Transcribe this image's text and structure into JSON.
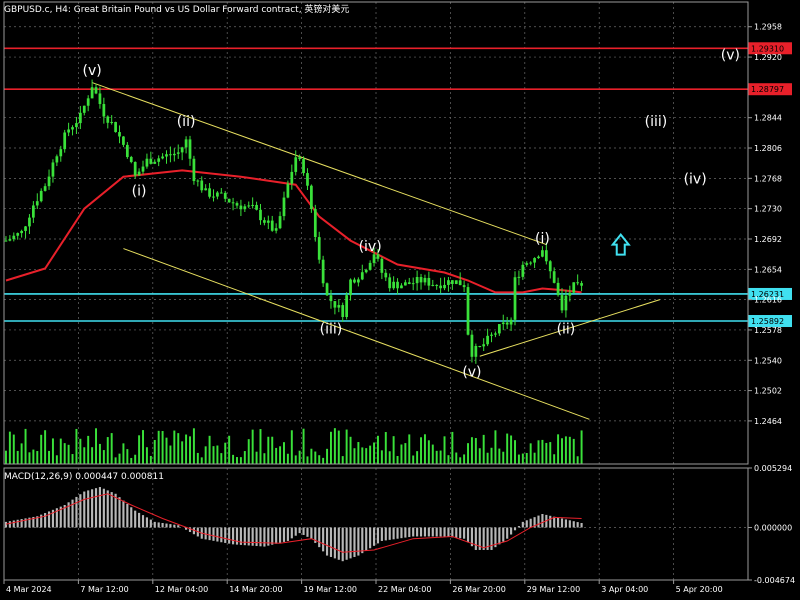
{
  "title": "GBPUSD.c, H4:  Great Britain Pound vs US Dollar Forward contract, 英镑对美元",
  "chart_data": [
    {
      "type": "candlestick",
      "symbol": "GBPUSD.c",
      "timeframe": "H4",
      "ylim": [
        1.241,
        1.2989
      ],
      "y_ticks": [
        1.2958,
        1.292,
        1.2844,
        1.2806,
        1.2768,
        1.273,
        1.2692,
        1.2654,
        1.2616,
        1.2578,
        1.254,
        1.2502,
        1.2464
      ],
      "x_ticks": [
        "4 Mar 2024",
        "7 Mar 12:00",
        "12 Mar 04:00",
        "14 Mar 20:00",
        "19 Mar 12:00",
        "22 Mar 04:00",
        "26 Mar 20:00",
        "29 Mar 12:00",
        "3 Apr 04:00",
        "5 Apr 20:00"
      ],
      "close_path": [
        [
          0,
          1.269
        ],
        [
          4,
          1.27
        ],
        [
          7,
          1.2735
        ],
        [
          10,
          1.276
        ],
        [
          13,
          1.28
        ],
        [
          16,
          1.283
        ],
        [
          19,
          1.2845
        ],
        [
          22,
          1.2885
        ],
        [
          25,
          1.285
        ],
        [
          28,
          1.283
        ],
        [
          31,
          1.28
        ],
        [
          33,
          1.277
        ],
        [
          36,
          1.279
        ],
        [
          40,
          1.2795
        ],
        [
          44,
          1.28
        ],
        [
          46,
          1.2815
        ],
        [
          48,
          1.277
        ],
        [
          51,
          1.275
        ],
        [
          55,
          1.2745
        ],
        [
          59,
          1.2735
        ],
        [
          63,
          1.273
        ],
        [
          66,
          1.2715
        ],
        [
          69,
          1.27
        ],
        [
          72,
          1.276
        ],
        [
          74,
          1.2795
        ],
        [
          76,
          1.278
        ],
        [
          78,
          1.273
        ],
        [
          80,
          1.2665
        ],
        [
          82,
          1.262
        ],
        [
          84,
          1.261
        ],
        [
          86,
          1.26
        ],
        [
          88,
          1.264
        ],
        [
          91,
          1.265
        ],
        [
          94,
          1.2675
        ],
        [
          96,
          1.265
        ],
        [
          98,
          1.2635
        ],
        [
          102,
          1.2635
        ],
        [
          106,
          1.264
        ],
        [
          110,
          1.2635
        ],
        [
          114,
          1.264
        ],
        [
          117,
          1.2635
        ],
        [
          118,
          1.2575
        ],
        [
          119,
          1.255
        ],
        [
          121,
          1.2555
        ],
        [
          123,
          1.2565
        ],
        [
          126,
          1.258
        ],
        [
          129,
          1.259
        ],
        [
          130,
          1.264
        ],
        [
          132,
          1.266
        ],
        [
          135,
          1.267
        ],
        [
          137,
          1.268
        ],
        [
          138,
          1.266
        ],
        [
          140,
          1.264
        ],
        [
          142,
          1.26
        ],
        [
          143,
          1.262
        ],
        [
          145,
          1.2632
        ],
        [
          147,
          1.263
        ]
      ],
      "moving_average": [
        [
          0,
          1.264
        ],
        [
          10,
          1.2655
        ],
        [
          20,
          1.273
        ],
        [
          30,
          1.277
        ],
        [
          45,
          1.2778
        ],
        [
          60,
          1.277
        ],
        [
          74,
          1.276
        ],
        [
          80,
          1.272
        ],
        [
          88,
          1.269
        ],
        [
          100,
          1.266
        ],
        [
          112,
          1.265
        ],
        [
          118,
          1.264
        ],
        [
          125,
          1.2625
        ],
        [
          132,
          1.2625
        ],
        [
          137,
          1.263
        ],
        [
          142,
          1.2628
        ],
        [
          147,
          1.2625
        ]
      ],
      "horizontal_levels": [
        {
          "price": 1.2931,
          "label": "1.29310",
          "color": "#e8202a"
        },
        {
          "price": 1.28797,
          "label": "1.28797",
          "color": "#e8202a"
        },
        {
          "price": 1.26231,
          "label": "1.26231",
          "color": "#40e0f0"
        },
        {
          "price": 1.25892,
          "label": "1.25892",
          "color": "#40e0f0"
        }
      ],
      "trendlines": [
        {
          "from": [
            22,
            1.2888
          ],
          "to": [
            138,
            1.2685
          ]
        },
        {
          "from": [
            30,
            1.268
          ],
          "to": [
            149,
            1.2466
          ]
        },
        {
          "from": [
            121,
            1.2545
          ],
          "to": [
            167,
            1.2616
          ]
        }
      ],
      "wave_labels": [
        {
          "text": "(v)",
          "x": 22,
          "y": 1.2904
        },
        {
          "text": "(ii)",
          "x": 46,
          "y": 1.284
        },
        {
          "text": "(i)",
          "x": 34,
          "y": 1.2753
        },
        {
          "text": "(iv)",
          "x": 93,
          "y": 1.2683
        },
        {
          "text": "(iii)",
          "x": 83,
          "y": 1.258
        },
        {
          "text": "(v)",
          "x": 119,
          "y": 1.2526
        },
        {
          "text": "(i)",
          "x": 137,
          "y": 1.2693
        },
        {
          "text": "(ii)",
          "x": 143,
          "y": 1.258
        },
        {
          "text": "(iii)",
          "x": 166,
          "y": 1.284
        },
        {
          "text": "(iv)",
          "x": 176,
          "y": 1.2768
        },
        {
          "text": "(v)",
          "x": 185,
          "y": 1.2923
        }
      ],
      "up_arrow": {
        "x": 157,
        "y": 1.2685,
        "color": "#40e0f0"
      },
      "ma_color": "#e8202a",
      "candle_color": "#3ae13a",
      "level_label_fg": "#000000"
    },
    {
      "type": "macd",
      "label": "MACD(12,26,9) 0.000447 0.000811",
      "ylim": [
        -0.004674,
        0.005294
      ],
      "y_ticks": [
        0.005294,
        0.0,
        -0.004674
      ],
      "y_tick_labels": [
        "0.005294",
        "0.000000",
        "-0.004674"
      ],
      "histogram_path": [
        [
          0,
          0.0005
        ],
        [
          8,
          0.001
        ],
        [
          15,
          0.002
        ],
        [
          20,
          0.0032
        ],
        [
          24,
          0.0036
        ],
        [
          28,
          0.003
        ],
        [
          33,
          0.0015
        ],
        [
          38,
          0.0005
        ],
        [
          44,
          0.0002
        ],
        [
          50,
          -0.001
        ],
        [
          58,
          -0.0015
        ],
        [
          66,
          -0.0017
        ],
        [
          72,
          -0.0012
        ],
        [
          75,
          -0.0005
        ],
        [
          78,
          -0.001
        ],
        [
          82,
          -0.0025
        ],
        [
          86,
          -0.003
        ],
        [
          90,
          -0.0025
        ],
        [
          96,
          -0.0012
        ],
        [
          104,
          -0.0008
        ],
        [
          112,
          -0.0008
        ],
        [
          117,
          -0.001
        ],
        [
          120,
          -0.002
        ],
        [
          124,
          -0.002
        ],
        [
          128,
          -0.001
        ],
        [
          132,
          0.0005
        ],
        [
          137,
          0.0012
        ],
        [
          142,
          0.0008
        ],
        [
          147,
          0.0004
        ]
      ],
      "signal_path": [
        [
          0,
          0.0003
        ],
        [
          10,
          0.001
        ],
        [
          20,
          0.0025
        ],
        [
          26,
          0.003
        ],
        [
          32,
          0.002
        ],
        [
          40,
          0.0008
        ],
        [
          50,
          -0.0005
        ],
        [
          60,
          -0.0013
        ],
        [
          70,
          -0.0014
        ],
        [
          78,
          -0.001
        ],
        [
          86,
          -0.0022
        ],
        [
          94,
          -0.002
        ],
        [
          104,
          -0.001
        ],
        [
          114,
          -0.0008
        ],
        [
          122,
          -0.0018
        ],
        [
          128,
          -0.0012
        ],
        [
          134,
          0.0
        ],
        [
          140,
          0.0009
        ],
        [
          147,
          0.0008
        ]
      ],
      "signal_color": "#e8202a",
      "histogram_color": "#b8b8b8"
    }
  ]
}
